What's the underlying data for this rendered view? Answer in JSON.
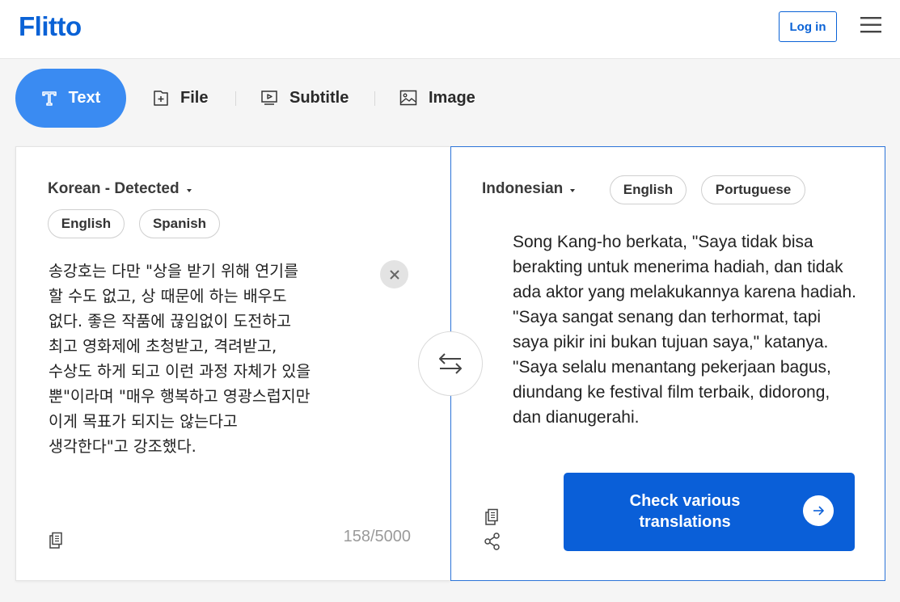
{
  "header": {
    "logo": "Flitto",
    "login_label": "Log in"
  },
  "tabs": [
    {
      "label": "Text",
      "icon": "text-icon",
      "active": true
    },
    {
      "label": "File",
      "icon": "file-add-icon",
      "active": false
    },
    {
      "label": "Subtitle",
      "icon": "subtitle-icon",
      "active": false
    },
    {
      "label": "Image",
      "icon": "image-icon",
      "active": false
    }
  ],
  "source": {
    "language": "Korean - Detected",
    "chips": [
      "English",
      "Spanish"
    ],
    "text": "송강호는 다만 \"상을 받기 위해 연기를\n할 수도 없고, 상 때문에 하는 배우도\n없다. 좋은 작품에 끊임없이 도전하고\n최고 영화제에 초청받고, 격려받고,\n수상도 하게 되고 이런 과정 자체가 있을\n뿐\"이라며 \"매우 행복하고 영광스럽지만\n이게 목표가 되지는 않는다고\n생각한다\"고 강조했다.",
    "char_count": "158/5000"
  },
  "target": {
    "language": "Indonesian",
    "chips": [
      "English",
      "Portuguese"
    ],
    "text": "Song Kang-ho berkata, \"Saya tidak bisa berakting untuk menerima hadiah, dan tidak ada aktor yang melakukannya karena hadiah. \"Saya sangat senang dan terhormat, tapi saya pikir ini bukan tujuan saya,\" katanya. \"Saya selalu menantang pekerjaan bagus, diundang ke festival film terbaik, didorong, dan dianugerahi.",
    "check_button_label": "Check various\ntranslations"
  },
  "colors": {
    "brand": "#0a62d6",
    "active_tab": "#3a8bf2",
    "cta": "#0a5fd8"
  }
}
